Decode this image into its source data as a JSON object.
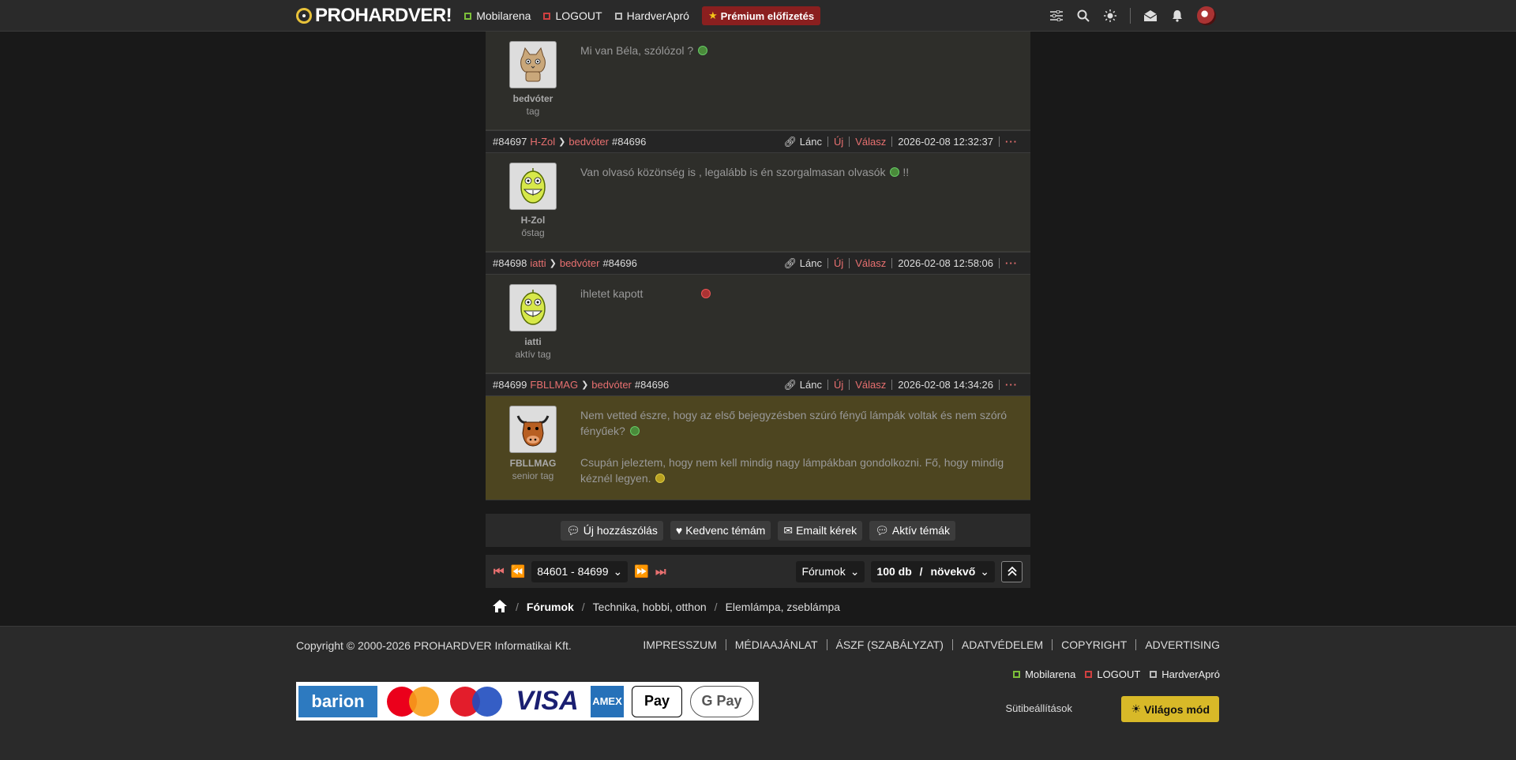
{
  "topnav": {
    "logo": "PROHARDVER!",
    "links": [
      {
        "label": "Mobilarena",
        "color": "#7cbf3a"
      },
      {
        "label": "LOGOUT",
        "color": "#d04040"
      },
      {
        "label": "HardverApró",
        "color": "#bbbbbb"
      }
    ],
    "premium": "Prémium előfizetés"
  },
  "posts": [
    {
      "author": "bedvóter",
      "rank": "tag",
      "avatar": "cat",
      "paragraphs": [
        "Mi van Béla, szólózol ?"
      ],
      "smile": "green"
    },
    {
      "num": "#84697",
      "user": "H-Zol",
      "target": "bedvóter",
      "target_num": "#84696",
      "actions": [
        "Lánc",
        "Új",
        "Válasz"
      ],
      "date": "2026-02-08 12:32:37",
      "author": "H-Zol",
      "rank": "őstag",
      "avatar": "yellow-grin",
      "paragraphs": [
        "Van olvasó közönség is , legalább is én szorgalmasan olvasók"
      ],
      "tail": "!!",
      "smile": "green"
    },
    {
      "num": "#84698",
      "user": "iatti",
      "target": "bedvóter",
      "target_num": "#84696",
      "actions": [
        "Lánc",
        "Új",
        "Válasz"
      ],
      "date": "2026-02-08 12:58:06",
      "author": "iatti",
      "rank": "aktív tag",
      "avatar": "yellow-grin",
      "paragraphs": [
        "ihletet kapott"
      ],
      "smile": "red"
    },
    {
      "num": "#84699",
      "user": "FBLLMAG",
      "target": "bedvóter",
      "target_num": "#84696",
      "actions": [
        "Lánc",
        "Új",
        "Válasz"
      ],
      "date": "2026-02-08 14:34:26",
      "author": "FBLLMAG",
      "rank": "senior tag",
      "avatar": "bull",
      "paragraphs": [
        "Nem vetted észre, hogy az első bejegyzésben szúró fényű lámpák voltak és nem szóró fényűek?",
        "Csupán jeleztem, hogy nem kell mindig nagy lámpákban gondolkozni. Fő, hogy mindig kéznél legyen."
      ],
      "highlight": true
    }
  ],
  "action_bar": [
    "Új hozzászólás",
    "Kedvenc témám",
    "Emailt kérek",
    "Aktív témák"
  ],
  "pager": {
    "range": "84601 - 84699",
    "forums": "Fórumok",
    "per_page": "100 db",
    "order": "növekvő"
  },
  "breadcrumb": [
    "Fórumok",
    "Technika, hobbi, otthon",
    "Elemlámpa, zseblámpa"
  ],
  "footer": {
    "copyright": "Copyright © 2000-2026 PROHARDVER Informatikai Kft.",
    "links": [
      "IMPRESSZUM",
      "MÉDIAAJÁNLAT",
      "ÁSZF (SZABÁLYZAT)",
      "ADATVÉDELEM",
      "COPYRIGHT",
      "ADVERTISING"
    ],
    "sites": [
      "Mobilarena",
      "LOGOUT",
      "HardverApró"
    ],
    "cookie": "Sütibeállítások",
    "light_mode": "Világos mód",
    "payments": [
      "barion",
      "Mastercard",
      "maestro",
      "VISA",
      "AMEX",
      "Pay",
      "G Pay"
    ]
  }
}
